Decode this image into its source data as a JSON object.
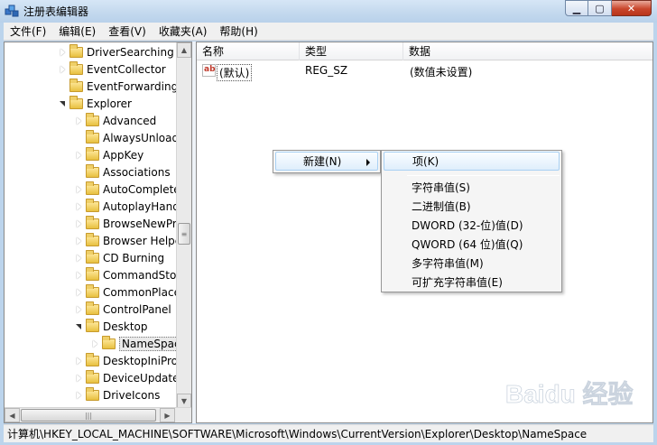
{
  "window": {
    "title": "注册表编辑器",
    "buttons": {
      "minimize": "▁",
      "maximize": "▢",
      "close": "✕"
    }
  },
  "menubar": {
    "items": [
      "文件(F)",
      "编辑(E)",
      "查看(V)",
      "收藏夹(A)",
      "帮助(H)"
    ]
  },
  "tree": {
    "items": [
      {
        "label": "DriverSearching",
        "level": 1,
        "state": "collapsed"
      },
      {
        "label": "EventCollector",
        "level": 1,
        "state": "collapsed"
      },
      {
        "label": "EventForwarding",
        "level": 1,
        "state": "none"
      },
      {
        "label": "Explorer",
        "level": 1,
        "state": "expanded"
      },
      {
        "label": "Advanced",
        "level": 2,
        "state": "collapsed"
      },
      {
        "label": "AlwaysUnloadI",
        "level": 2,
        "state": "none"
      },
      {
        "label": "AppKey",
        "level": 2,
        "state": "collapsed"
      },
      {
        "label": "Associations",
        "level": 2,
        "state": "none"
      },
      {
        "label": "AutoComplete",
        "level": 2,
        "state": "collapsed"
      },
      {
        "label": "AutoplayHand",
        "level": 2,
        "state": "collapsed"
      },
      {
        "label": "BrowseNewPro",
        "level": 2,
        "state": "collapsed"
      },
      {
        "label": "Browser Helpe",
        "level": 2,
        "state": "collapsed"
      },
      {
        "label": "CD Burning",
        "level": 2,
        "state": "collapsed"
      },
      {
        "label": "CommandStor",
        "level": 2,
        "state": "collapsed"
      },
      {
        "label": "CommonPlace",
        "level": 2,
        "state": "collapsed"
      },
      {
        "label": "ControlPanel",
        "level": 2,
        "state": "collapsed"
      },
      {
        "label": "Desktop",
        "level": 2,
        "state": "expanded"
      },
      {
        "label": "NameSpac",
        "level": 3,
        "state": "collapsed",
        "selected": true
      },
      {
        "label": "DesktopIniPro",
        "level": 2,
        "state": "collapsed"
      },
      {
        "label": "DeviceUpdateI",
        "level": 2,
        "state": "collapsed"
      },
      {
        "label": "DriveIcons",
        "level": 2,
        "state": "collapsed"
      }
    ]
  },
  "list": {
    "columns": [
      "名称",
      "类型",
      "数据"
    ],
    "rows": [
      {
        "name": "(默认)",
        "type": "REG_SZ",
        "data": "(数值未设置)",
        "icon": "ab-string-icon"
      }
    ]
  },
  "context_menu": {
    "item": "新建(N)"
  },
  "submenu": {
    "items": [
      "项(K)",
      "字符串值(S)",
      "二进制值(B)",
      "DWORD (32-位)值(D)",
      "QWORD (64 位)值(Q)",
      "多字符串值(M)",
      "可扩充字符串值(E)"
    ],
    "highlighted_index": 0
  },
  "statusbar": {
    "path": "计算机\\HKEY_LOCAL_MACHINE\\SOFTWARE\\Microsoft\\Windows\\CurrentVersion\\Explorer\\Desktop\\NameSpace"
  },
  "watermark": {
    "text": "Baidu 经验"
  }
}
